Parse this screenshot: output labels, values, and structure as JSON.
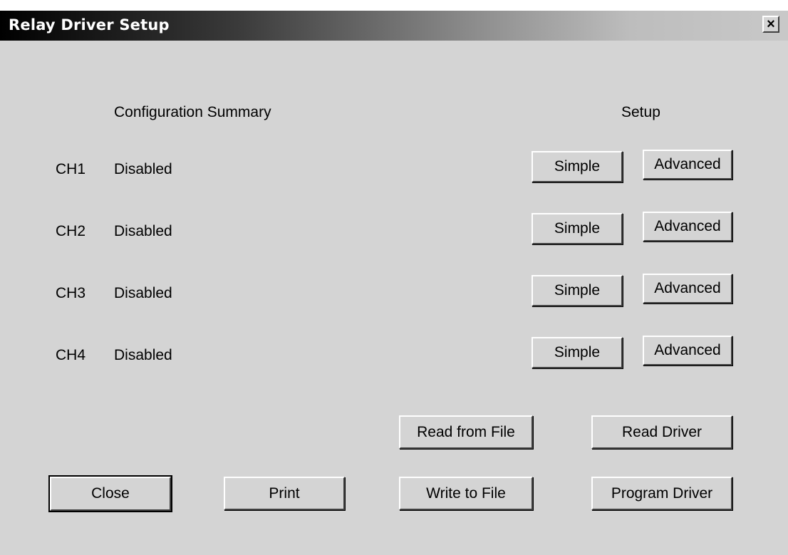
{
  "window": {
    "title": "Relay Driver Setup"
  },
  "headers": {
    "summary": "Configuration Summary",
    "setup": "Setup"
  },
  "channels": [
    {
      "name": "CH1",
      "status": "Disabled",
      "simple_label": "Simple",
      "advanced_label": "Advanced"
    },
    {
      "name": "CH2",
      "status": "Disabled",
      "simple_label": "Simple",
      "advanced_label": "Advanced"
    },
    {
      "name": "CH3",
      "status": "Disabled",
      "simple_label": "Simple",
      "advanced_label": "Advanced"
    },
    {
      "name": "CH4",
      "status": "Disabled",
      "simple_label": "Simple",
      "advanced_label": "Advanced"
    }
  ],
  "actions": {
    "read_from_file": "Read from File",
    "read_driver": "Read Driver",
    "close": "Close",
    "print": "Print",
    "write_to_file": "Write to File",
    "program_driver": "Program Driver"
  }
}
